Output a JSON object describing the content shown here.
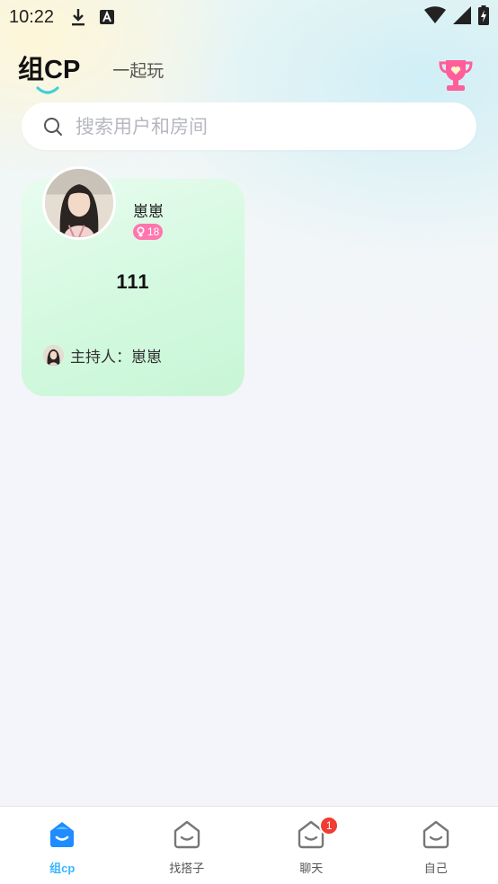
{
  "status_bar": {
    "time": "10:22",
    "icons": [
      "download-icon",
      "keyboard-a-icon",
      "wifi-icon",
      "signal-icon",
      "battery-charging-icon"
    ]
  },
  "header": {
    "tabs": [
      {
        "label": "组CP",
        "active": true
      },
      {
        "label": "一起玩",
        "active": false
      }
    ],
    "right_icon": "trophy-icon"
  },
  "search": {
    "placeholder": "搜索用户和房间",
    "value": ""
  },
  "rooms": [
    {
      "host_name": "崽崽",
      "gender": "female",
      "age": "18",
      "title": "111",
      "host_label": "主持人：崽崽"
    }
  ],
  "bottom_nav": {
    "items": [
      {
        "label": "组cp",
        "icon": "home-face-icon",
        "active": true
      },
      {
        "label": "找搭子",
        "icon": "home-face-icon",
        "active": false
      },
      {
        "label": "聊天",
        "icon": "chat-face-icon",
        "active": false,
        "badge": "1"
      },
      {
        "label": "自己",
        "icon": "profile-face-icon",
        "active": false
      }
    ]
  },
  "colors": {
    "accent": "#3ab7ff",
    "active_nav_icon": "#1f8cff",
    "card_green": "#d3f9df",
    "age_badge": "#ff76ae",
    "badge_red": "#f03c32"
  }
}
